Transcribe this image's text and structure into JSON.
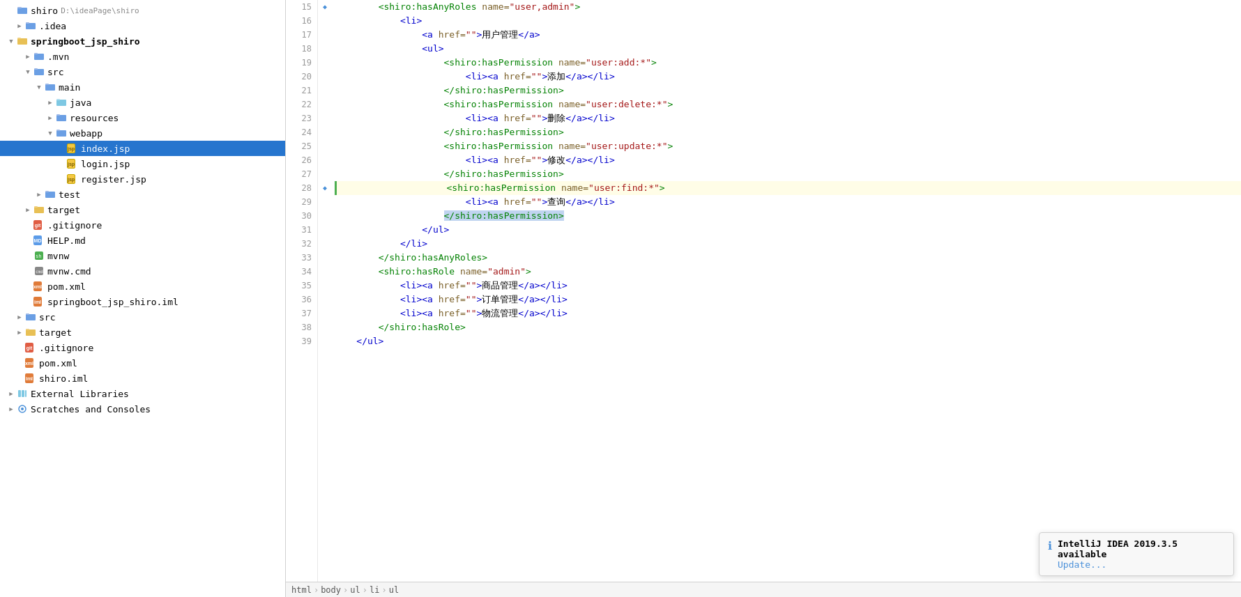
{
  "sidebar": {
    "root": {
      "label": "shiro",
      "path": "D:\\ideaPage\\shiro"
    },
    "items": [
      {
        "id": "idea",
        "label": ".idea",
        "indent": 1,
        "type": "folder-blue",
        "collapsed": true,
        "arrow": "▶"
      },
      {
        "id": "springboot_jsp_shiro",
        "label": "springboot_jsp_shiro",
        "indent": 1,
        "type": "folder-yellow",
        "collapsed": false,
        "arrow": "▼",
        "bold": true
      },
      {
        "id": "mvn",
        "label": ".mvn",
        "indent": 2,
        "type": "folder-blue",
        "collapsed": true,
        "arrow": "▶"
      },
      {
        "id": "src-main",
        "label": "src",
        "indent": 2,
        "type": "folder-blue",
        "collapsed": false,
        "arrow": "▼"
      },
      {
        "id": "main",
        "label": "main",
        "indent": 3,
        "type": "folder-blue",
        "collapsed": false,
        "arrow": "▼"
      },
      {
        "id": "java",
        "label": "java",
        "indent": 4,
        "type": "folder-src-blue",
        "collapsed": true,
        "arrow": "▶"
      },
      {
        "id": "resources",
        "label": "resources",
        "indent": 4,
        "type": "folder-blue",
        "collapsed": true,
        "arrow": "▶"
      },
      {
        "id": "webapp",
        "label": "webapp",
        "indent": 4,
        "type": "folder-blue",
        "collapsed": false,
        "arrow": "▼"
      },
      {
        "id": "index-jsp",
        "label": "index.jsp",
        "indent": 5,
        "type": "jsp",
        "selected": true
      },
      {
        "id": "login-jsp",
        "label": "login.jsp",
        "indent": 5,
        "type": "jsp"
      },
      {
        "id": "register-jsp",
        "label": "register.jsp",
        "indent": 5,
        "type": "jsp"
      },
      {
        "id": "test",
        "label": "test",
        "indent": 3,
        "type": "folder-blue",
        "collapsed": true,
        "arrow": "▶"
      },
      {
        "id": "target-main",
        "label": "target",
        "indent": 2,
        "type": "folder-yellow",
        "collapsed": true,
        "arrow": "▶"
      },
      {
        "id": "gitignore-main",
        "label": ".gitignore",
        "indent": 2,
        "type": "git"
      },
      {
        "id": "help-md",
        "label": "HELP.md",
        "indent": 2,
        "type": "md"
      },
      {
        "id": "mvnw",
        "label": "mvnw",
        "indent": 2,
        "type": "sh"
      },
      {
        "id": "mvnw-cmd",
        "label": "mvnw.cmd",
        "indent": 2,
        "type": "cmd"
      },
      {
        "id": "pom-xml",
        "label": "pom.xml",
        "indent": 2,
        "type": "xml"
      },
      {
        "id": "iml-file",
        "label": "springboot_jsp_shiro.iml",
        "indent": 2,
        "type": "iml"
      },
      {
        "id": "src-root",
        "label": "src",
        "indent": 1,
        "type": "folder-blue",
        "collapsed": true,
        "arrow": "▶"
      },
      {
        "id": "target-root",
        "label": "target",
        "indent": 1,
        "type": "folder-yellow",
        "collapsed": true,
        "arrow": "▶"
      },
      {
        "id": "gitignore-root",
        "label": ".gitignore",
        "indent": 1,
        "type": "git"
      },
      {
        "id": "pom-root",
        "label": "pom.xml",
        "indent": 1,
        "type": "xml"
      },
      {
        "id": "shiro-iml",
        "label": "shiro.iml",
        "indent": 1,
        "type": "iml"
      },
      {
        "id": "ext-libs",
        "label": "External Libraries",
        "indent": 0,
        "type": "ext",
        "collapsed": true,
        "arrow": "▶"
      },
      {
        "id": "scratches",
        "label": "Scratches and Consoles",
        "indent": 0,
        "type": "scratches",
        "collapsed": true,
        "arrow": "▶"
      }
    ]
  },
  "editor": {
    "lines": [
      {
        "num": 15,
        "accent": false,
        "gutter": "◆",
        "content": [
          {
            "text": "        ",
            "class": ""
          },
          {
            "text": "<shiro:hasAnyRoles",
            "class": "shiro-tag"
          },
          {
            "text": " ",
            "class": ""
          },
          {
            "text": "name=",
            "class": "attr-name"
          },
          {
            "text": "\"user,admin\"",
            "class": "attr-val-red"
          },
          {
            "text": ">",
            "class": "shiro-tag"
          }
        ]
      },
      {
        "num": 16,
        "accent": false,
        "gutter": "",
        "content": [
          {
            "text": "            ",
            "class": ""
          },
          {
            "text": "<li>",
            "class": "html-tag"
          }
        ]
      },
      {
        "num": 17,
        "accent": false,
        "gutter": "",
        "content": [
          {
            "text": "                ",
            "class": ""
          },
          {
            "text": "<a",
            "class": "html-tag"
          },
          {
            "text": " ",
            "class": ""
          },
          {
            "text": "href=",
            "class": "attr-name"
          },
          {
            "text": "\"\"",
            "class": "attr-val-red"
          },
          {
            "text": ">",
            "class": "html-tag"
          },
          {
            "text": "用户管理",
            "class": "text"
          },
          {
            "text": "</a>",
            "class": "html-tag"
          }
        ]
      },
      {
        "num": 18,
        "accent": false,
        "gutter": "",
        "content": [
          {
            "text": "                ",
            "class": ""
          },
          {
            "text": "<ul>",
            "class": "html-tag"
          }
        ]
      },
      {
        "num": 19,
        "accent": false,
        "gutter": "",
        "content": [
          {
            "text": "                    ",
            "class": ""
          },
          {
            "text": "<shiro:hasPermission",
            "class": "shiro-tag"
          },
          {
            "text": " ",
            "class": ""
          },
          {
            "text": "name=",
            "class": "attr-name"
          },
          {
            "text": "\"user:add:*\"",
            "class": "attr-val-red"
          },
          {
            "text": ">",
            "class": "shiro-tag"
          }
        ]
      },
      {
        "num": 20,
        "accent": false,
        "gutter": "",
        "content": [
          {
            "text": "                        ",
            "class": ""
          },
          {
            "text": "<li>",
            "class": "html-tag"
          },
          {
            "text": "<a",
            "class": "html-tag"
          },
          {
            "text": " ",
            "class": ""
          },
          {
            "text": "href=",
            "class": "attr-name"
          },
          {
            "text": "\"\"",
            "class": "attr-val-red"
          },
          {
            "text": ">",
            "class": "html-tag"
          },
          {
            "text": "添加",
            "class": "text"
          },
          {
            "text": "</a>",
            "class": "html-tag"
          },
          {
            "text": "</li>",
            "class": "html-tag"
          }
        ]
      },
      {
        "num": 21,
        "accent": false,
        "gutter": "",
        "content": [
          {
            "text": "                    ",
            "class": ""
          },
          {
            "text": "</shiro:hasPermission>",
            "class": "shiro-tag"
          }
        ]
      },
      {
        "num": 22,
        "accent": false,
        "gutter": "",
        "content": [
          {
            "text": "                    ",
            "class": ""
          },
          {
            "text": "<shiro:hasPermission",
            "class": "shiro-tag"
          },
          {
            "text": " ",
            "class": ""
          },
          {
            "text": "name=",
            "class": "attr-name"
          },
          {
            "text": "\"user:delete:*\"",
            "class": "attr-val-red"
          },
          {
            "text": ">",
            "class": "shiro-tag"
          }
        ]
      },
      {
        "num": 23,
        "accent": false,
        "gutter": "",
        "content": [
          {
            "text": "                        ",
            "class": ""
          },
          {
            "text": "<li>",
            "class": "html-tag"
          },
          {
            "text": "<a",
            "class": "html-tag"
          },
          {
            "text": " ",
            "class": ""
          },
          {
            "text": "href=",
            "class": "attr-name"
          },
          {
            "text": "\"\"",
            "class": "attr-val-red"
          },
          {
            "text": ">",
            "class": "html-tag"
          },
          {
            "text": "删除",
            "class": "text"
          },
          {
            "text": "</a>",
            "class": "html-tag"
          },
          {
            "text": "</li>",
            "class": "html-tag"
          }
        ]
      },
      {
        "num": 24,
        "accent": false,
        "gutter": "",
        "content": [
          {
            "text": "                    ",
            "class": ""
          },
          {
            "text": "</shiro:hasPermission>",
            "class": "shiro-tag"
          }
        ]
      },
      {
        "num": 25,
        "accent": false,
        "gutter": "",
        "content": [
          {
            "text": "                    ",
            "class": ""
          },
          {
            "text": "<shiro:hasPermission",
            "class": "shiro-tag"
          },
          {
            "text": " ",
            "class": ""
          },
          {
            "text": "name=",
            "class": "attr-name"
          },
          {
            "text": "\"user:update:*\"",
            "class": "attr-val-red"
          },
          {
            "text": ">",
            "class": "shiro-tag"
          }
        ]
      },
      {
        "num": 26,
        "accent": false,
        "gutter": "",
        "content": [
          {
            "text": "                        ",
            "class": ""
          },
          {
            "text": "<li>",
            "class": "html-tag"
          },
          {
            "text": "<a",
            "class": "html-tag"
          },
          {
            "text": " ",
            "class": ""
          },
          {
            "text": "href=",
            "class": "attr-name"
          },
          {
            "text": "\"\"",
            "class": "attr-val-red"
          },
          {
            "text": ">",
            "class": "html-tag"
          },
          {
            "text": "修改",
            "class": "text"
          },
          {
            "text": "</a>",
            "class": "html-tag"
          },
          {
            "text": "</li>",
            "class": "html-tag"
          }
        ]
      },
      {
        "num": 27,
        "accent": false,
        "gutter": "",
        "content": [
          {
            "text": "                    ",
            "class": ""
          },
          {
            "text": "</shiro:hasPermission>",
            "class": "shiro-tag"
          }
        ]
      },
      {
        "num": 28,
        "accent": true,
        "gutter": "◆",
        "content": [
          {
            "text": "                    ",
            "class": ""
          },
          {
            "text": "<shiro:hasPermission",
            "class": "shiro-tag"
          },
          {
            "text": " ",
            "class": ""
          },
          {
            "text": "name=",
            "class": "attr-name"
          },
          {
            "text": "\"user:find:*\"",
            "class": "attr-val-red"
          },
          {
            "text": ">",
            "class": "shiro-tag"
          }
        ]
      },
      {
        "num": 29,
        "accent": false,
        "gutter": "",
        "content": [
          {
            "text": "                        ",
            "class": ""
          },
          {
            "text": "<li>",
            "class": "html-tag"
          },
          {
            "text": "<a",
            "class": "html-tag"
          },
          {
            "text": " ",
            "class": ""
          },
          {
            "text": "href=",
            "class": "attr-name"
          },
          {
            "text": "\"\"",
            "class": "attr-val-red"
          },
          {
            "text": ">",
            "class": "html-tag"
          },
          {
            "text": "查询",
            "class": "text"
          },
          {
            "text": "</a>",
            "class": "html-tag"
          },
          {
            "text": "</li>",
            "class": "html-tag"
          }
        ]
      },
      {
        "num": 30,
        "accent": false,
        "gutter": "",
        "content": [
          {
            "text": "                    ",
            "class": ""
          },
          {
            "text": "</shiro:hasPermission>",
            "class": "shiro-tag"
          },
          {
            "text": "",
            "class": "selected-bg"
          }
        ]
      },
      {
        "num": 31,
        "accent": false,
        "gutter": "",
        "content": [
          {
            "text": "                ",
            "class": ""
          },
          {
            "text": "</ul>",
            "class": "html-tag"
          }
        ]
      },
      {
        "num": 32,
        "accent": false,
        "gutter": "",
        "content": [
          {
            "text": "            ",
            "class": ""
          },
          {
            "text": "</li>",
            "class": "html-tag"
          }
        ]
      },
      {
        "num": 33,
        "accent": false,
        "gutter": "",
        "content": [
          {
            "text": "        ",
            "class": ""
          },
          {
            "text": "</shiro:hasAnyRoles>",
            "class": "shiro-tag"
          }
        ]
      },
      {
        "num": 34,
        "accent": false,
        "gutter": "",
        "content": [
          {
            "text": "        ",
            "class": ""
          },
          {
            "text": "<shiro:hasRole",
            "class": "shiro-tag"
          },
          {
            "text": " ",
            "class": ""
          },
          {
            "text": "name=",
            "class": "attr-name"
          },
          {
            "text": "\"admin\"",
            "class": "attr-val-red"
          },
          {
            "text": ">",
            "class": "shiro-tag"
          }
        ]
      },
      {
        "num": 35,
        "accent": false,
        "gutter": "",
        "content": [
          {
            "text": "            ",
            "class": ""
          },
          {
            "text": "<li>",
            "class": "html-tag"
          },
          {
            "text": "<a",
            "class": "html-tag"
          },
          {
            "text": " ",
            "class": ""
          },
          {
            "text": "href=",
            "class": "attr-name"
          },
          {
            "text": "\"\"",
            "class": "attr-val-red"
          },
          {
            "text": ">",
            "class": "html-tag"
          },
          {
            "text": "商品管理",
            "class": "text"
          },
          {
            "text": "</a>",
            "class": "html-tag"
          },
          {
            "text": "</li>",
            "class": "html-tag"
          }
        ]
      },
      {
        "num": 36,
        "accent": false,
        "gutter": "",
        "content": [
          {
            "text": "            ",
            "class": ""
          },
          {
            "text": "<li>",
            "class": "html-tag"
          },
          {
            "text": "<a",
            "class": "html-tag"
          },
          {
            "text": " ",
            "class": ""
          },
          {
            "text": "href=",
            "class": "attr-name"
          },
          {
            "text": "\"\"",
            "class": "attr-val-red"
          },
          {
            "text": ">",
            "class": "html-tag"
          },
          {
            "text": "订单管理",
            "class": "text"
          },
          {
            "text": "</a>",
            "class": "html-tag"
          },
          {
            "text": "</li>",
            "class": "html-tag"
          }
        ]
      },
      {
        "num": 37,
        "accent": false,
        "gutter": "",
        "content": [
          {
            "text": "            ",
            "class": ""
          },
          {
            "text": "<li>",
            "class": "html-tag"
          },
          {
            "text": "<a",
            "class": "html-tag"
          },
          {
            "text": " ",
            "class": ""
          },
          {
            "text": "href=",
            "class": "attr-name"
          },
          {
            "text": "\"\"",
            "class": "attr-val-red"
          },
          {
            "text": ">",
            "class": "html-tag"
          },
          {
            "text": "物流管理",
            "class": "text"
          },
          {
            "text": "</a>",
            "class": "html-tag"
          },
          {
            "text": "</li>",
            "class": "html-tag"
          }
        ]
      },
      {
        "num": 38,
        "accent": false,
        "gutter": "",
        "content": [
          {
            "text": "        ",
            "class": ""
          },
          {
            "text": "</shiro:hasRole>",
            "class": "shiro-tag"
          }
        ]
      },
      {
        "num": 39,
        "accent": false,
        "gutter": "",
        "content": [
          {
            "text": "    ",
            "class": ""
          },
          {
            "text": "</ul>",
            "class": "html-tag"
          }
        ]
      }
    ],
    "highlighted_line": 28
  },
  "status_bar": {
    "breadcrumbs": [
      "html",
      "body",
      "ul",
      "li",
      "ul"
    ]
  },
  "notification": {
    "title": "IntelliJ IDEA 2019.3.5 available",
    "link_label": "Update..."
  },
  "colors": {
    "shiro_tag": "#008000",
    "html_tag": "#0000CD",
    "attr_name": "#795E26",
    "attr_value": "#A31515",
    "selected_bg": "#2675CE",
    "highlight_bg": "#fffde7",
    "line30_selection": "#c0d4f0"
  }
}
